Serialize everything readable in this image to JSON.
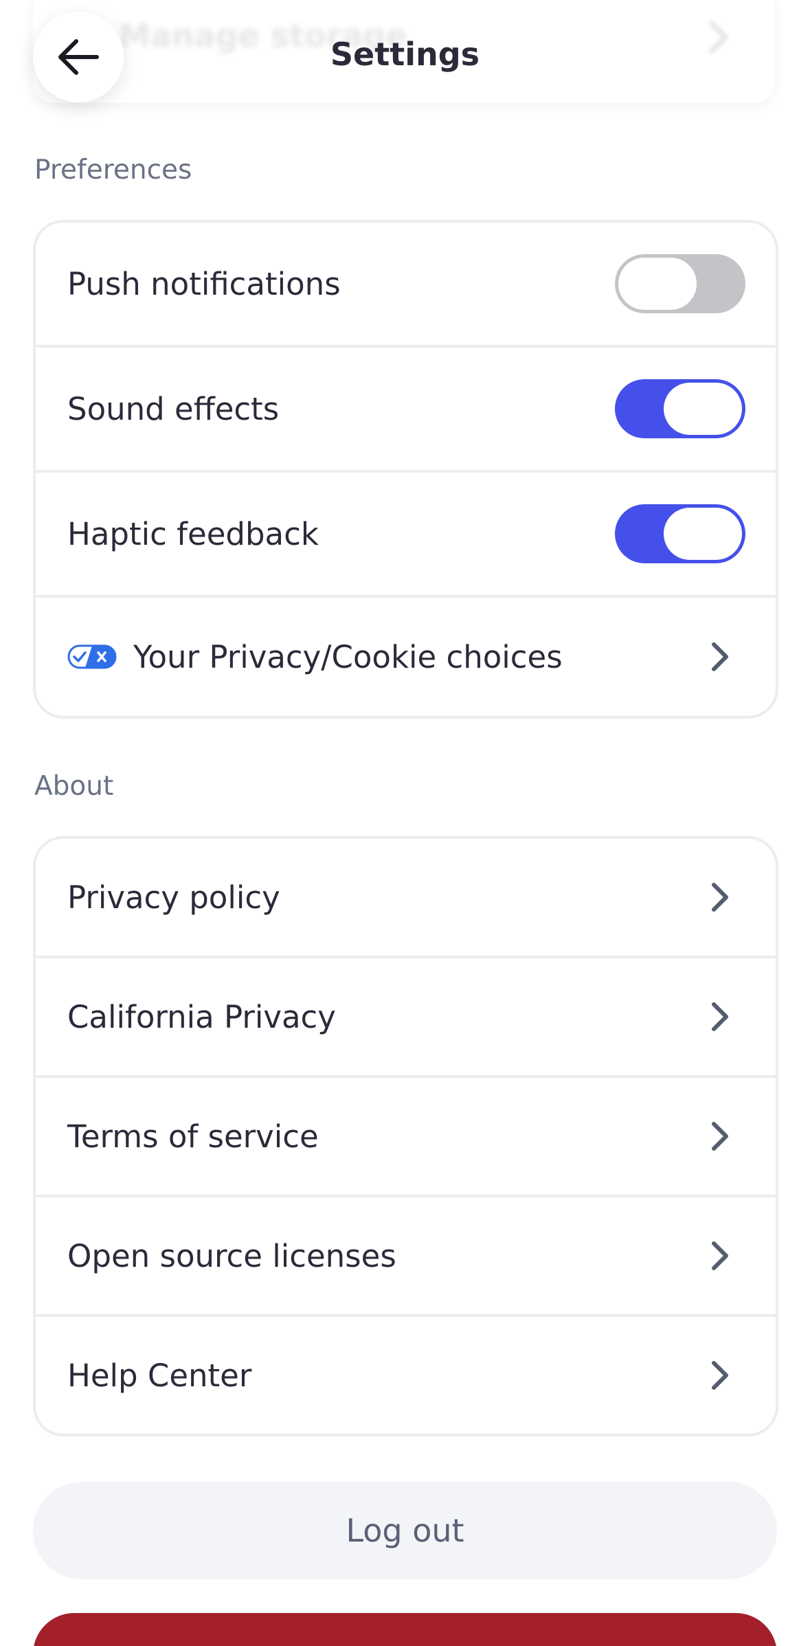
{
  "header": {
    "title": "Settings",
    "back_icon": "arrow-left-icon",
    "background_row_label": "Manage storage"
  },
  "preferences": {
    "section_label": "Preferences",
    "items": [
      {
        "label": "Push notifications",
        "type": "toggle",
        "state": "off"
      },
      {
        "label": "Sound effects",
        "type": "toggle",
        "state": "on"
      },
      {
        "label": "Haptic feedback",
        "type": "toggle",
        "state": "on"
      },
      {
        "label": "Your Privacy/Cookie choices",
        "type": "link",
        "icon": "privacy-options-icon"
      }
    ]
  },
  "about": {
    "section_label": "About",
    "items": [
      {
        "label": "Privacy policy"
      },
      {
        "label": "California Privacy"
      },
      {
        "label": "Terms of service"
      },
      {
        "label": "Open source licenses"
      },
      {
        "label": "Help Center"
      }
    ]
  },
  "actions": {
    "logout_label": "Log out"
  },
  "colors": {
    "accent": "#4550ea",
    "toggle_off": "#c4c4c8",
    "danger": "#a31f2a",
    "text": "#2a2a3a",
    "muted": "#6b7285"
  }
}
